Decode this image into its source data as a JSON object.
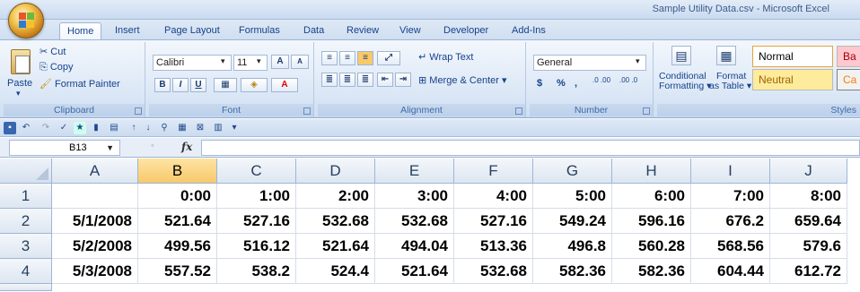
{
  "window": {
    "title": "Sample Utility Data.csv - Microsoft Excel"
  },
  "tabs": [
    "Home",
    "Insert",
    "Page Layout",
    "Formulas",
    "Data",
    "Review",
    "View",
    "Developer",
    "Add-Ins"
  ],
  "ribbon": {
    "clipboard": {
      "label": "Clipboard",
      "paste": "Paste",
      "cut": "Cut",
      "copy": "Copy",
      "format_painter": "Format Painter"
    },
    "font": {
      "label": "Font",
      "name": "Calibri",
      "size": "11",
      "bold": "B",
      "italic": "I",
      "underline": "U",
      "grow": "A",
      "shrink": "A"
    },
    "alignment": {
      "label": "Alignment",
      "wrap_text": "Wrap Text",
      "merge_center": "Merge & Center"
    },
    "number": {
      "label": "Number",
      "format": "General",
      "currency": "$",
      "percent": "%",
      "comma": ",",
      "inc_decimal": ".0 .00",
      "dec_decimal": ".00 .0"
    },
    "styles": {
      "label": "Styles",
      "conditional": "Conditional",
      "conditional2": "Formatting",
      "format_as": "Format",
      "format_as2": "as Table",
      "normal": "Normal",
      "neutral": "Neutral",
      "bad": "Ba",
      "calc": "Ca"
    }
  },
  "formula_bar": {
    "name_box": "B13",
    "fx": "fx",
    "value": ""
  },
  "sheet": {
    "columns": [
      "A",
      "B",
      "C",
      "D",
      "E",
      "F",
      "G",
      "H",
      "I",
      "J"
    ],
    "rows": [
      {
        "num": "1",
        "cells": [
          "",
          "0:00",
          "1:00",
          "2:00",
          "3:00",
          "4:00",
          "5:00",
          "6:00",
          "7:00",
          "8:00"
        ]
      },
      {
        "num": "2",
        "cells": [
          "5/1/2008",
          "521.64",
          "527.16",
          "532.68",
          "532.68",
          "527.16",
          "549.24",
          "596.16",
          "676.2",
          "659.64"
        ]
      },
      {
        "num": "3",
        "cells": [
          "5/2/2008",
          "499.56",
          "516.12",
          "521.64",
          "494.04",
          "513.36",
          "496.8",
          "560.28",
          "568.56",
          "579.6"
        ]
      },
      {
        "num": "4",
        "cells": [
          "5/3/2008",
          "557.52",
          "538.2",
          "524.4",
          "521.64",
          "532.68",
          "582.36",
          "582.36",
          "604.44",
          "612.72"
        ]
      }
    ],
    "selected_column": "B",
    "colors": {
      "selected_header": "#f8c86a",
      "header": "#dde6f1",
      "accent": "#15428b"
    }
  }
}
